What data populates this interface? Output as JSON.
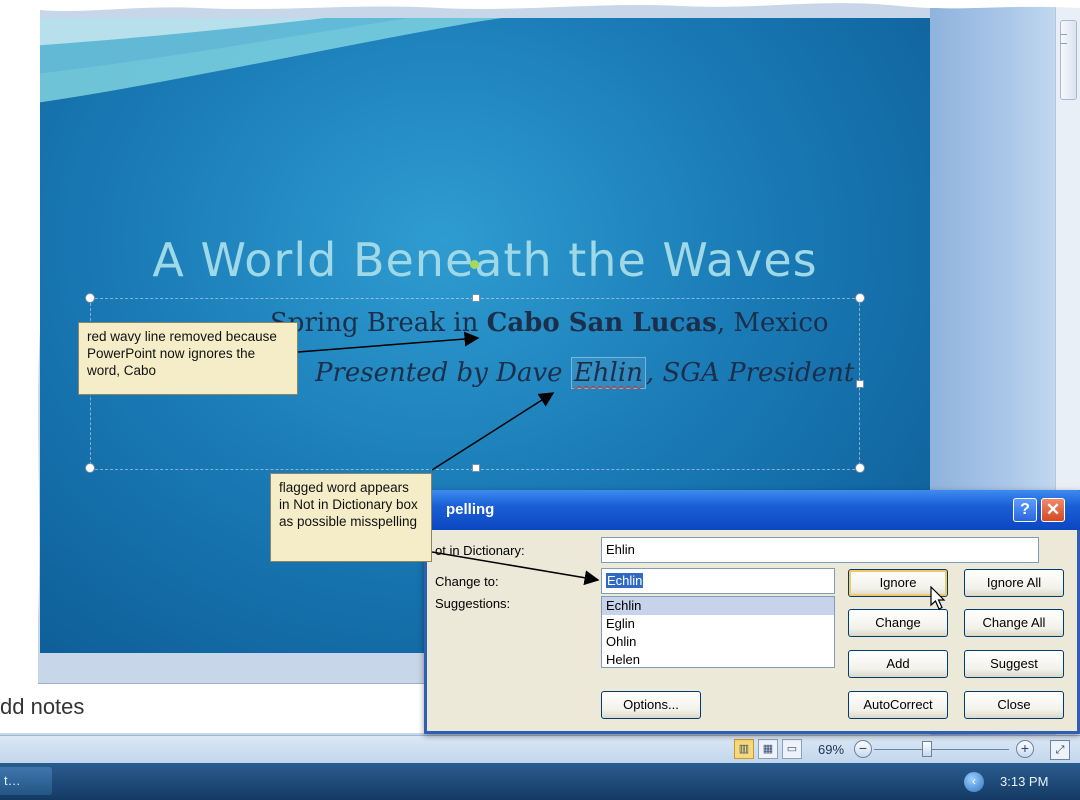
{
  "slide": {
    "title": "A World Beneath the Waves",
    "subtitle_line1": {
      "pre": "Spring Break in ",
      "bold": "Cabo San Lucas",
      "post": ", Mexico"
    },
    "subtitle_line2": {
      "pre": "Presented by Dave ",
      "flagged": "Ehlin",
      "post": ", SGA President"
    }
  },
  "notes": {
    "placeholder": "dd notes"
  },
  "status_bar": {
    "zoom_level": "69%",
    "zoom_out_symbol": "−",
    "zoom_in_symbol": "+"
  },
  "taskbar": {
    "task_label": "t…",
    "clock": "3:13 PM"
  },
  "spelling_dialog": {
    "title": "pelling",
    "help_symbol": "?",
    "close_symbol": "✕",
    "not_in_dictionary_label": "ot in Dictionary:",
    "not_in_dictionary_value": "Ehlin",
    "change_to_label": "Change to:",
    "change_to_value": "Echlin",
    "suggestions_label": "Suggestions:",
    "suggestions": [
      "Echlin",
      "Eglin",
      "Ohlin",
      "Helen"
    ],
    "buttons": {
      "ignore": "Ignore",
      "ignore_all": "Ignore All",
      "change": "Change",
      "change_all": "Change All",
      "add": "Add",
      "suggest": "Suggest",
      "options": "Options...",
      "autocorrect": "AutoCorrect",
      "close": "Close"
    }
  },
  "callouts": {
    "cabo": "red wavy line removed because PowerPoint now ignores the word, Cabo",
    "flagged": "flagged word appears in Not in Dictionary box as possible misspelling"
  },
  "colors": {
    "slide_blue": "#1a7bb6",
    "title_text": "#9fd8e6",
    "dialog_title_blue": "#1a5fd6",
    "callout_bg": "#f5edc7"
  }
}
